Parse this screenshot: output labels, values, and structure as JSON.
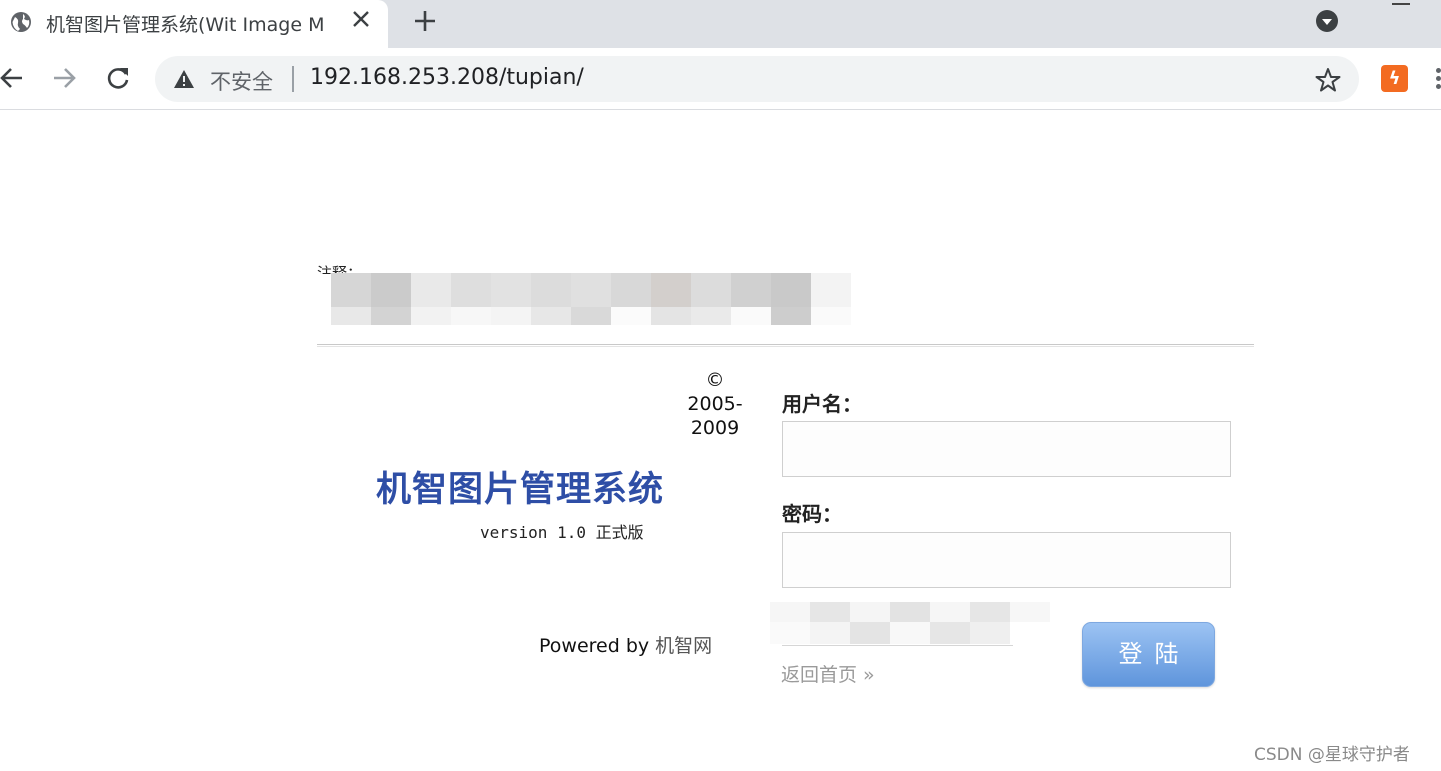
{
  "browser": {
    "tab": {
      "title": "机智图片管理系统(Wit Image M",
      "icon": "globe-icon"
    },
    "omnibox": {
      "security_text": "不安全",
      "url": "192.168.253.208/tupian/"
    },
    "extension_glyph": "ϟ"
  },
  "page": {
    "note_label": "注释：",
    "copyright": {
      "symbol": "©",
      "line1": "2005-",
      "line2": "2009"
    },
    "brand": {
      "title": "机智图片管理系统",
      "version": "version 1.0 正式版"
    },
    "powered": {
      "prefix": "Powered by ",
      "link": "机智网"
    },
    "form": {
      "username_label": "用户名：",
      "username_value": "",
      "password_label": "密码：",
      "password_value": "",
      "home_link": "返回首页 »",
      "login_button": "登陆"
    }
  },
  "watermark": "CSDN @星球守护者",
  "colors": {
    "brand": "#2e4ea6",
    "button_top": "#9cc3f3",
    "button_bottom": "#5f95dc",
    "extension": "#f36b21"
  }
}
